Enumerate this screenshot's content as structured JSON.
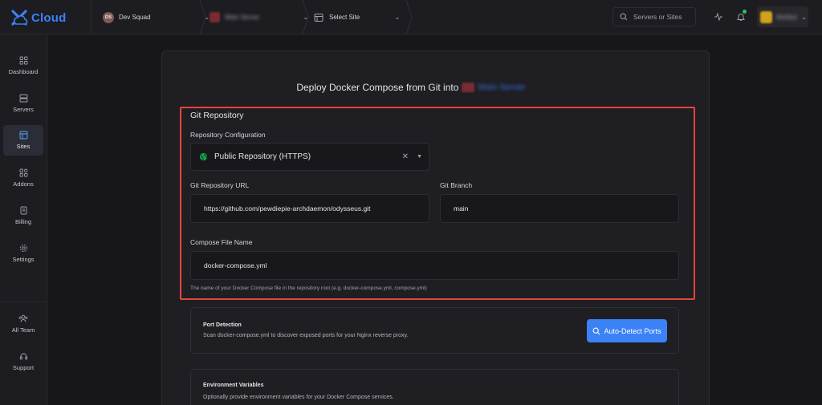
{
  "brand": {
    "name": "Cloud"
  },
  "topbar": {
    "team": {
      "initials": "DS",
      "label": "Dev Squad"
    },
    "server": {
      "label": "Main Server"
    },
    "site": {
      "label": "Select Site"
    },
    "search_placeholder": "Servers or Sites",
    "user": {
      "name": "Mofidul"
    }
  },
  "sidebar": {
    "items": [
      {
        "label": "Dashboard",
        "icon": "grid-icon"
      },
      {
        "label": "Servers",
        "icon": "server-icon"
      },
      {
        "label": "Sites",
        "icon": "browser-window-icon",
        "active": true
      },
      {
        "label": "Addons",
        "icon": "addons-icon"
      },
      {
        "label": "Billing",
        "icon": "receipt-icon"
      },
      {
        "label": "Settings",
        "icon": "gear-icon"
      },
      {
        "label": "All Team",
        "icon": "team-icon"
      },
      {
        "label": "Support",
        "icon": "headset-icon"
      }
    ]
  },
  "page": {
    "title_prefix": "Deploy Docker Compose from Git into",
    "server_name": "Main Server"
  },
  "git_repo": {
    "section_title": "Git Repository",
    "config_label": "Repository Configuration",
    "config_value": "Public Repository (HTTPS)",
    "url_label": "Git Repository URL",
    "url_value": "https://github.com/pewdiepie-archdaemon/odysseus.git",
    "branch_label": "Git Branch",
    "branch_value": "main",
    "compose_label": "Compose File Name",
    "compose_value": "docker-compose.yml",
    "compose_hint": "The name of your Docker Compose file in the repository root (e.g. docker-compose.yml, compose.yml)"
  },
  "port_detection": {
    "title": "Port Detection",
    "description": "Scan docker-compose.yml to discover exposed ports for your Nginx reverse proxy.",
    "button_label": "Auto-Detect Ports"
  },
  "env_vars": {
    "title": "Environment Variables",
    "description": "Optionally provide environment variables for your Docker Compose services."
  },
  "colors": {
    "accent": "#3b82f6",
    "highlight_border": "#e5463a",
    "background": "#17171b",
    "notify_dot": "#22c55e"
  }
}
